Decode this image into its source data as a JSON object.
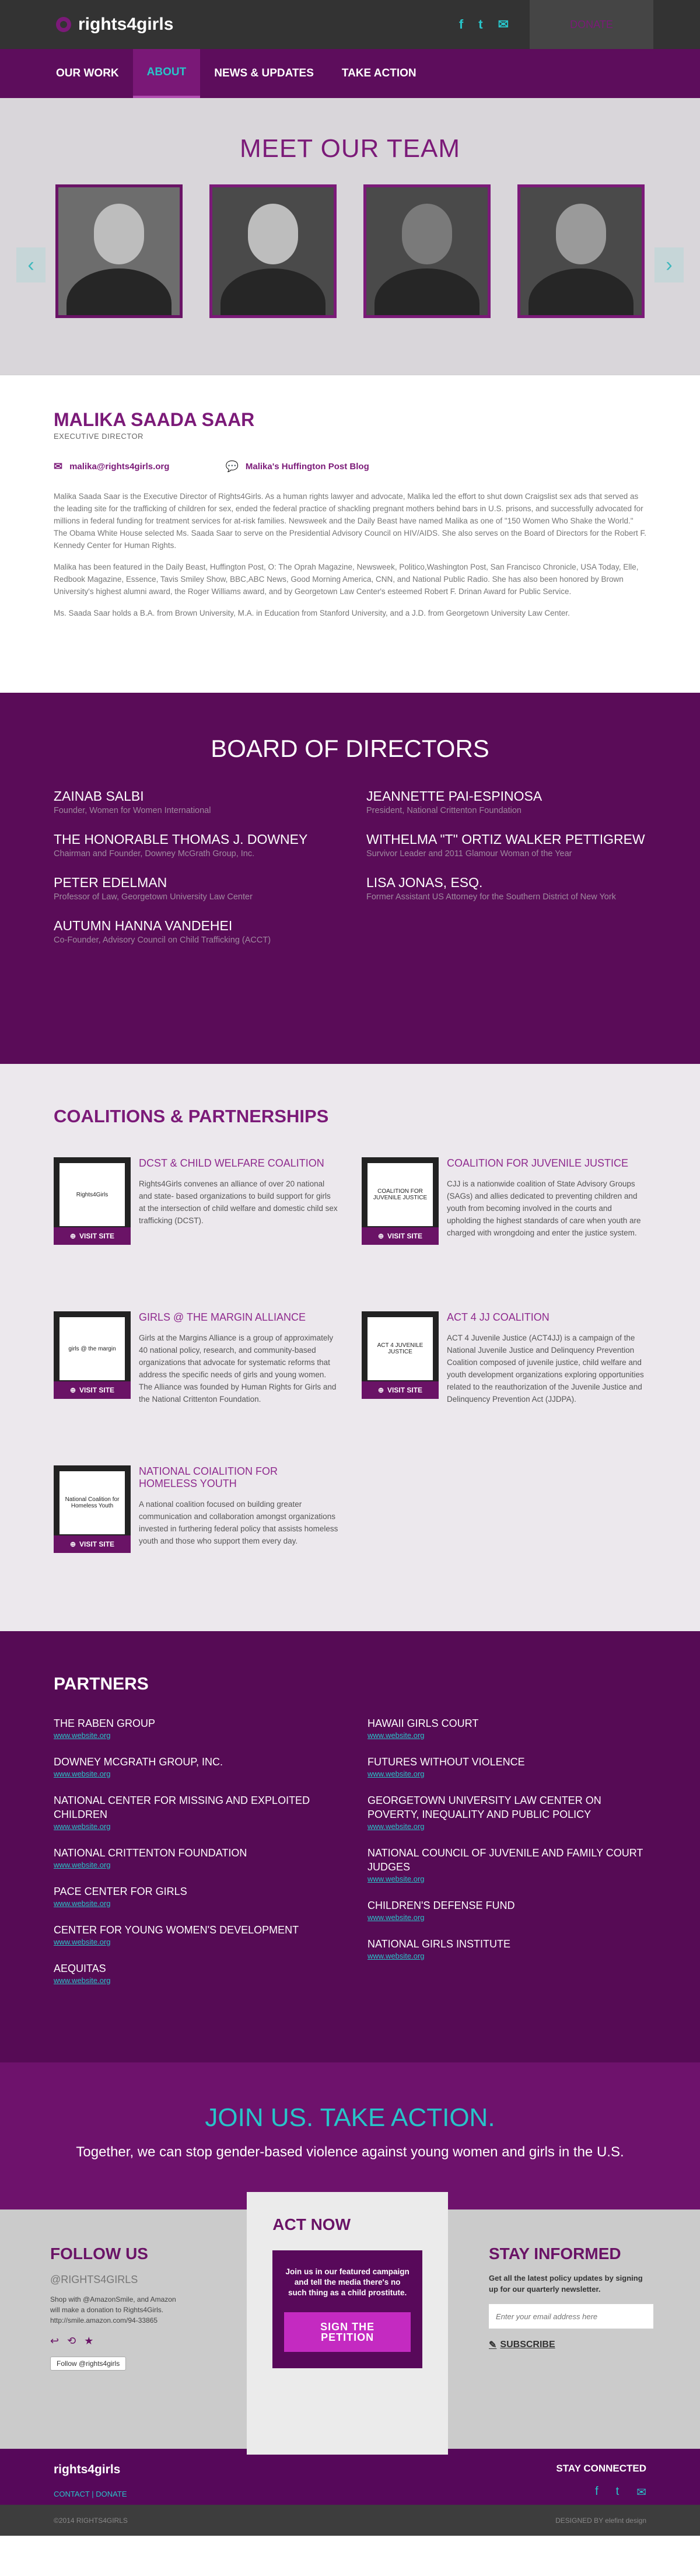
{
  "header": {
    "logo": "rights4girls",
    "donate": "DONATE",
    "social": [
      "f",
      "t",
      "✉"
    ]
  },
  "nav": [
    "OUR WORK",
    "ABOUT",
    "NEWS & UPDATES",
    "TAKE ACTION"
  ],
  "team": {
    "title": "MEET OUR TEAM",
    "prev": "‹",
    "next": "›"
  },
  "profile": {
    "name": "MALIKA SAADA SAAR",
    "role": "EXECUTIVE DIRECTOR",
    "email": "malika@rights4girls.org",
    "blog": "Malika's Huffington Post Blog",
    "bio": [
      "Malika Saada Saar is the Executive Director of Rights4Girls. As a human rights lawyer and advocate, Malika led the effort to shut down Craigslist sex ads that served as the leading site for the trafficking of children for sex, ended the federal practice of shackling pregnant mothers behind bars in U.S. prisons, and successfully advocated for millions in federal funding for treatment services for at-risk families. Newsweek and the Daily Beast have named Malika as one of \"150 Women Who Shake the World.\" The Obama White House selected Ms. Saada Saar to serve on the Presidential Advisory Council on HIV/AIDS. She also serves on the Board of Directors for the Robert F. Kennedy Center for Human Rights.",
      "Malika has been featured in the Daily Beast, Huffington Post, O: The Oprah Magazine, Newsweek, Politico,Washington Post, San Francisco Chronicle, USA Today, Elle, Redbook Magazine, Essence, Tavis Smiley Show, BBC,ABC News, Good Morning America, CNN, and National Public Radio. She has also been honored by Brown University's highest alumni award, the Roger Williams award, and by Georgetown Law Center's esteemed Robert F. Drinan Award for Public Service.",
      "Ms. Saada Saar holds a B.A. from Brown University, M.A. in Education from Stanford University, and a J.D. from Georgetown University Law Center."
    ]
  },
  "board": {
    "title": "BOARD OF DIRECTORS",
    "members": [
      {
        "name": "ZAINAB SALBI",
        "title": "Founder, Women for Women International"
      },
      {
        "name": "JEANNETTE PAI-ESPINOSA",
        "title": "President, National Crittenton Foundation"
      },
      {
        "name": "THE HONORABLE THOMAS J. DOWNEY",
        "title": "Chairman and Founder, Downey McGrath Group, Inc."
      },
      {
        "name": "WITHELMA \"T\" ORTIZ WALKER PETTIGREW",
        "title": "Survivor Leader and 2011 Glamour Woman of the Year"
      },
      {
        "name": "PETER EDELMAN",
        "title": "Professor of Law, Georgetown University Law Center"
      },
      {
        "name": "LISA JONAS, ESQ.",
        "title": "Former Assistant US Attorney for the Southern District of New York"
      },
      {
        "name": "AUTUMN HANNA VANDEHEI",
        "title": "Co-Founder, Advisory Council on Child Trafficking (ACCT)"
      }
    ]
  },
  "coalitions": {
    "title": "COALITIONS & PARTNERSHIPS",
    "visit": "VISIT SITE",
    "items": [
      {
        "title": "DCST & CHILD WELFARE COALITION",
        "logo": "Rights4Girls",
        "text": "Rights4Girls convenes an alliance of over 20 national and state- based organizations to build support for girls at the intersection of child welfare and domestic child sex trafficking (DCST)."
      },
      {
        "title": "COALITION FOR JUVENILE JUSTICE",
        "logo": "COALITION FOR JUVENILE JUSTICE",
        "text": "CJJ is a nationwide coalition of State Advisory Groups (SAGs) and allies dedicated to preventing children and youth from becoming involved in the courts and upholding the highest standards of care when youth are charged with wrongdoing and enter the justice system."
      },
      {
        "title": "GIRLS @ THE MARGIN ALLIANCE",
        "logo": "girls @ the margin",
        "text": "Girls at the Margins Alliance is a group of approximately 40 national policy, research, and community-based organizations that advocate for systematic reforms that address the specific needs of girls and young women. The Alliance was  founded by Human Rights for Girls and the National Crittenton Foundation."
      },
      {
        "title": "ACT 4 JJ COALITION",
        "logo": "ACT 4 JUVENILE JUSTICE",
        "text": "ACT 4 Juvenile Justice (ACT4JJ) is a campaign of the National Juvenile Justice and Delinquency Prevention Coalition composed of juvenile justice, child welfare and youth development organizations exploring opportunities related to the reauthorization of the Juvenile Justice and Delinquency Prevention Act (JJDPA)."
      },
      {
        "title": "NATIONAL COIALITION FOR HOMELESS YOUTH",
        "logo": "National Coalition for Homeless Youth",
        "text": "A national coalition focused on building greater communication and collaboration amongst organizations invested in furthering federal policy that assists homeless youth and those who support them every day."
      }
    ]
  },
  "partners": {
    "title": "PARTNERS",
    "link": "www.website.org",
    "left": [
      "THE RABEN GROUP",
      "DOWNEY MCGRATH GROUP, INC.",
      "NATIONAL CENTER FOR MISSING AND EXPLOITED CHILDREN",
      "NATIONAL CRITTENTON FOUNDATION",
      "PACE CENTER FOR GIRLS",
      "CENTER FOR YOUNG WOMEN'S DEVELOPMENT",
      "AEQUITAS"
    ],
    "right": [
      "HAWAII GIRLS COURT",
      "FUTURES WITHOUT VIOLENCE",
      "GEORGETOWN UNIVERSITY LAW CENTER ON POVERTY, INEQUALITY AND PUBLIC POLICY",
      "NATIONAL COUNCIL OF JUVENILE AND FAMILY COURT JUDGES",
      "CHILDREN'S DEFENSE FUND",
      "NATIONAL GIRLS INSTITUTE"
    ]
  },
  "join": {
    "title": "JOIN US. TAKE ACTION.",
    "text": "Together, we can stop gender-based violence against young women and girls in the U.S."
  },
  "follow": {
    "title": "FOLLOW US",
    "handle": "@RIGHTS4GIRLS",
    "text": "Shop with @AmazonSmile, and Amazon will make a donation to Rights4Girls. http://smile.amazon.com/94-33865",
    "button": "Follow @rights4girls"
  },
  "act": {
    "title": "ACT NOW",
    "text": "Join us in our featured campaign and tell the media there's no such thing as a child prostitute.",
    "button": "SIGN THE PETITION"
  },
  "inform": {
    "title": "STAY INFORMED",
    "text": "Get all the latest policy updates by signing up for our quarterly newsletter.",
    "placeholder": "Enter your email address here",
    "subscribe": "SUBSCRIBE"
  },
  "bottom": {
    "logo": "rights4girls",
    "links": [
      "CONTACT",
      "DONATE"
    ],
    "sep": "|",
    "connected": "STAY CONNECTED",
    "copyright": "©2014 RIGHTS4GIRLS",
    "designed": "DESIGNED BY",
    "designer": "elefint design"
  }
}
